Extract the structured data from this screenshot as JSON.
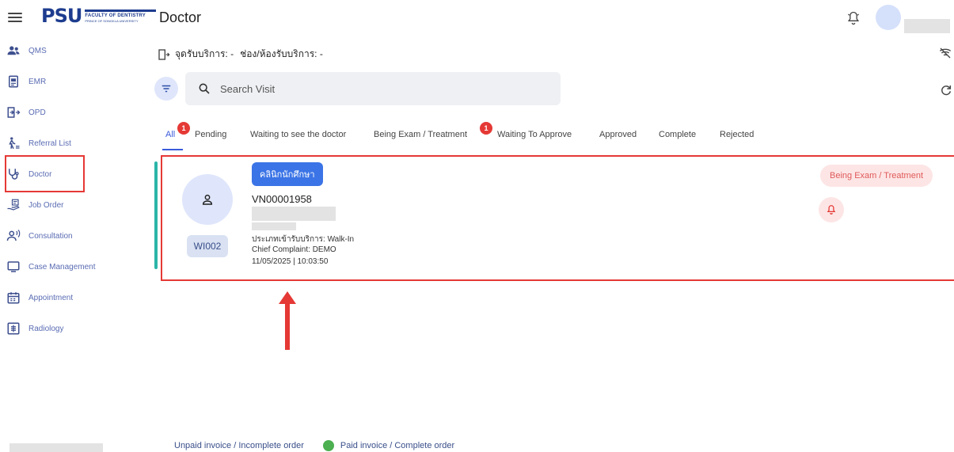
{
  "header": {
    "title": "Doctor",
    "logo_mark": "PSU",
    "logo_faculty": "FACULTY OF DENTISTRY",
    "logo_university": "PRINCE OF SONGKLA UNIVERSITY"
  },
  "sidebar": {
    "items": [
      {
        "label": "QMS",
        "icon": "people-icon"
      },
      {
        "label": "EMR",
        "icon": "document-icon"
      },
      {
        "label": "OPD",
        "icon": "door-enter-icon"
      },
      {
        "label": "Referral List",
        "icon": "walking-person-icon"
      },
      {
        "label": "Doctor",
        "icon": "stethoscope-icon"
      },
      {
        "label": "Job Order",
        "icon": "hand-list-icon"
      },
      {
        "label": "Consultation",
        "icon": "person-speaking-icon"
      },
      {
        "label": "Case Management",
        "icon": "monitor-icon"
      },
      {
        "label": "Appointment",
        "icon": "calendar-icon"
      },
      {
        "label": "Radiology",
        "icon": "xray-icon"
      }
    ],
    "selected": "Doctor"
  },
  "service": {
    "point_label": "จุดรับบริการ: -",
    "room_label": "ช่อง/ห้องรับบริการ: -"
  },
  "search": {
    "placeholder": "Search Visit"
  },
  "tabs": [
    {
      "label": "All",
      "active": true,
      "badge": "1"
    },
    {
      "label": "Pending"
    },
    {
      "label": "Waiting to see the doctor"
    },
    {
      "label": "Being Exam / Treatment",
      "badge": "1"
    },
    {
      "label": "Waiting To Approve"
    },
    {
      "label": "Approved"
    },
    {
      "label": "Complete"
    },
    {
      "label": "Rejected"
    }
  ],
  "visit_card": {
    "clinic": "คลินิกนักศึกษา",
    "vn": "VN00001958",
    "queue": "WI002",
    "service_type": "ประเภทเข้ารับบริการ: Walk-In",
    "chief_complaint": "Chief Complaint: DEMO",
    "datetime": "11/05/2025 | 10:03:50",
    "status": "Being Exam / Treatment",
    "accent_color": "#2bb5a8"
  },
  "legend": {
    "unpaid": "Unpaid invoice / Incomplete order",
    "paid": "Paid invoice / Complete order",
    "paid_color": "#4caf50"
  },
  "colors": {
    "brand": "#1d3c8f",
    "primary": "#3b74e6",
    "highlight": "#e53935",
    "status_text": "#e05a5a"
  }
}
